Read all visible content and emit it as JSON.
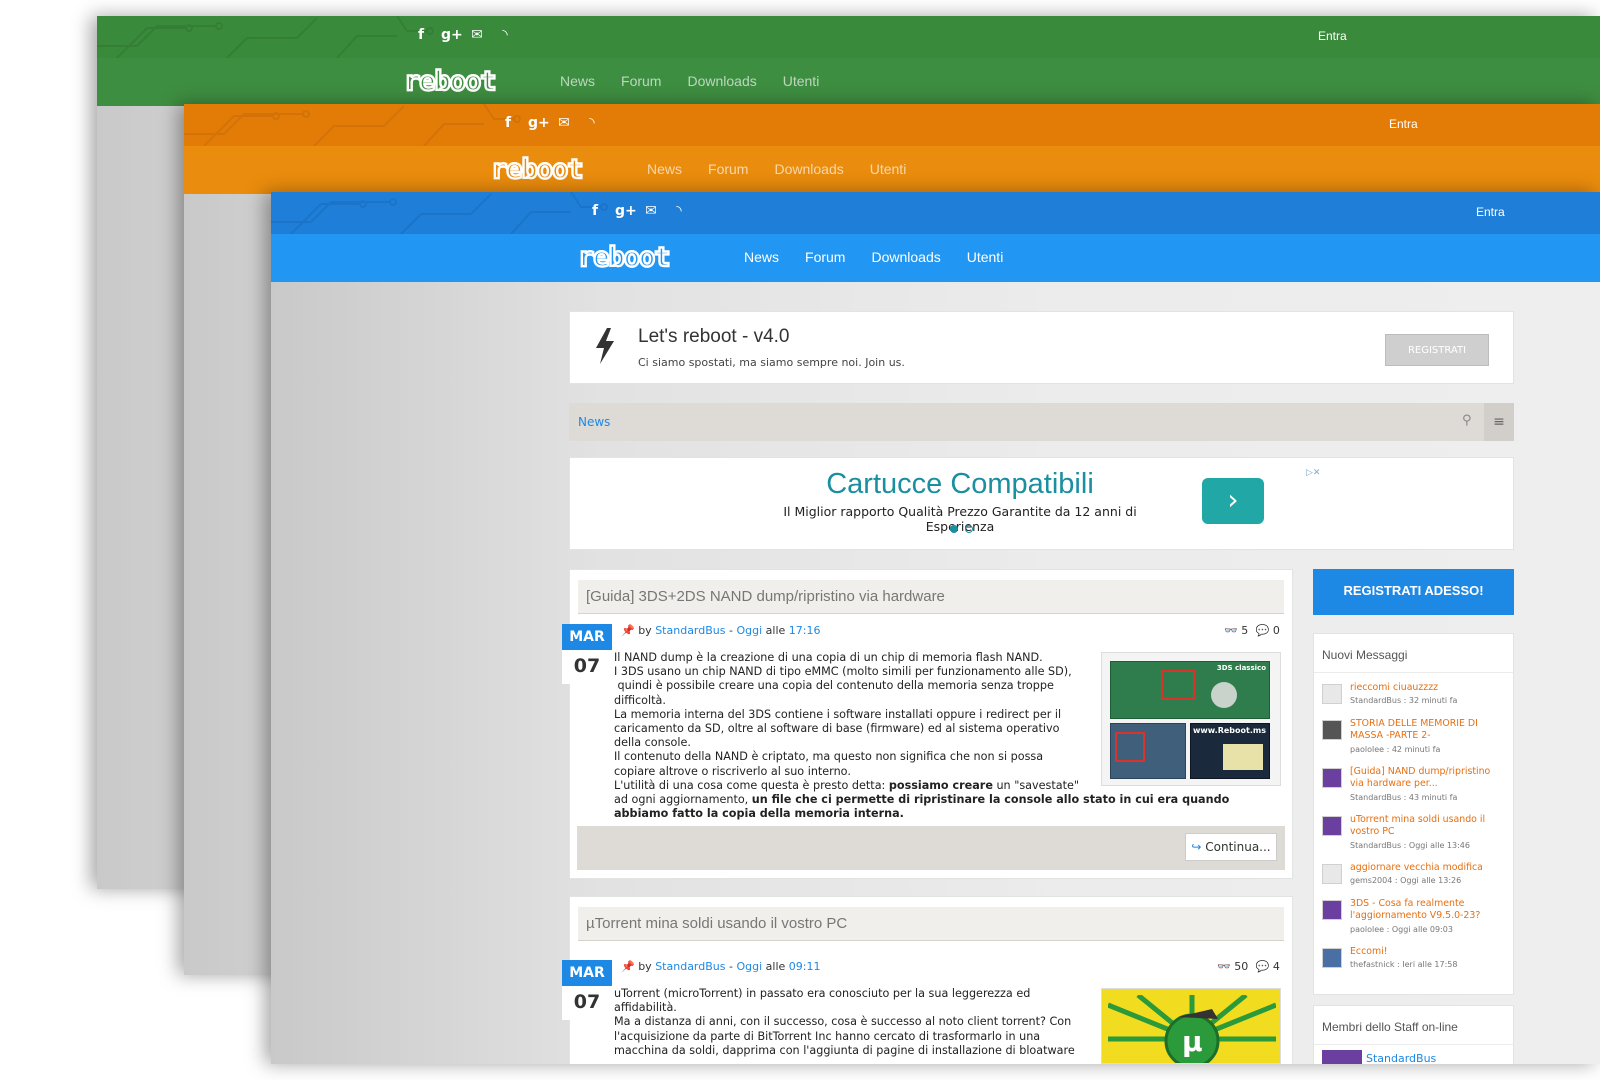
{
  "windows": [
    {
      "theme": "green",
      "topbar_color": "#3d8b3d",
      "navbar_color": "#3e8e41",
      "entra": "Entra",
      "logo": "reboot",
      "nav": [
        "News",
        "Forum",
        "Downloads",
        "Utenti"
      ]
    },
    {
      "theme": "orange",
      "topbar_color": "#e07b0a",
      "navbar_color": "#e88b0c",
      "entra": "Entra",
      "logo": "reboot",
      "nav": [
        "News",
        "Forum",
        "Downloads",
        "Utenti"
      ]
    },
    {
      "theme": "blue",
      "topbar_color": "#1f7fd8",
      "navbar_color": "#2196f3",
      "entra": "Entra",
      "logo": "reboot",
      "nav": [
        "News",
        "Forum",
        "Downloads",
        "Utenti"
      ]
    }
  ],
  "social_icons": [
    "facebook-icon",
    "google-plus-icon",
    "mail-icon",
    "rss-icon"
  ],
  "welcome": {
    "title": "Let's reboot - v4.0",
    "subtitle": "Ci siamo spostati, ma siamo sempre noi. Join us.",
    "button": "REGISTRATI"
  },
  "breadcrumb": {
    "label": "News"
  },
  "ad": {
    "title": "Cartucce Compatibili",
    "subtitle": "Il Miglior rapporto Qualità Prezzo Garantite da 12 anni di Esperienza"
  },
  "posts": [
    {
      "title": "[Guida] 3DS+2DS NAND dump/ripristino via hardware",
      "month": "MAR",
      "day": "07",
      "by": "by",
      "author": "StandardBus",
      "sep": " - ",
      "when": "Oggi",
      "at": " alle ",
      "time": "17:16",
      "views": "5",
      "comments": "0",
      "thumb_label_top": "3DS classico",
      "thumb_label_mid": "www.Reboot.ms",
      "body": "Il NAND dump è la creazione di una copia di un chip di memoria flash NAND.\nI 3DS usano un chip NAND di tipo eMMC (molto simili per funzionamento alle SD),\n quindi è possibile creare una copia del contenuto della memoria senza troppe\ndifficoltà.\nLa memoria interna del 3DS contiene i software installati oppure i redirect per il\ncaricamento da SD, oltre al software di base (firmware) ed al sistema operativo\ndella console.\nIl contenuto della NAND è criptato, ma questo non significa che non si possa\ncopiare altrove o riscriverlo al suo interno.",
      "body_last_1": "L'utilità di una cosa come questa è presto detta: ",
      "body_last_1b": "possiamo creare",
      "body_last_1c": " un \"savestate\"",
      "body_last_2": "ad ogni aggiornamento, ",
      "body_last_2b": "un file che ci permette di ripristinare la console allo stato in cui era quando",
      "body_last_3": "abbiamo fatto la copia della memoria interna.",
      "continue": "Continua..."
    },
    {
      "title": "µTorrent mina soldi usando il vostro PC",
      "month": "MAR",
      "day": "07",
      "by": "by",
      "author": "StandardBus",
      "sep": " - ",
      "when": "Oggi",
      "at": " alle ",
      "time": "09:11",
      "views": "50",
      "comments": "4",
      "body": "uTorrent (microTorrent) in passato era conosciuto per la sua leggerezza ed\naffidabilità.\nMa a distanza di anni, con il successo, cosa è successo al noto client torrent? Con\nl'acquisizione da parte di BitTorrent Inc hanno cercato di trasformarlo in una\nmacchina da soldi, dapprima con l'aggiunta di pagine di installazione di bloatware"
    }
  ],
  "sidebar": {
    "register_button": "REGISTRATI ADESSO!",
    "latest_title": "Nuovi Messaggi",
    "messages": [
      {
        "title": "rieccomi ciuauzzzz",
        "meta": "StandardBus : 32 minuti fa"
      },
      {
        "title": "STORIA DELLE MEMORIE DI MASSA -PARTE 2-",
        "meta": "paololee : 42 minuti fa"
      },
      {
        "title": "[Guida] NAND dump/ripristino via hardware per...",
        "meta": "StandardBus : 43 minuti fa"
      },
      {
        "title": "uTorrent mina soldi usando il vostro PC",
        "meta": "StandardBus : Oggi alle 13:46"
      },
      {
        "title": "aggiornare vecchia modifica",
        "meta": "gems2004 : Oggi alle 13:26"
      },
      {
        "title": "3DS - Cosa fa realmente l'aggiornamento V9.5.0-23?",
        "meta": "paololee : Oggi alle 09:03"
      },
      {
        "title": "Eccomi!",
        "meta": "thefastnick : Ieri alle 17:58"
      }
    ],
    "staff_title": "Membri dello Staff on-line",
    "staff_member": "StandardBus"
  }
}
